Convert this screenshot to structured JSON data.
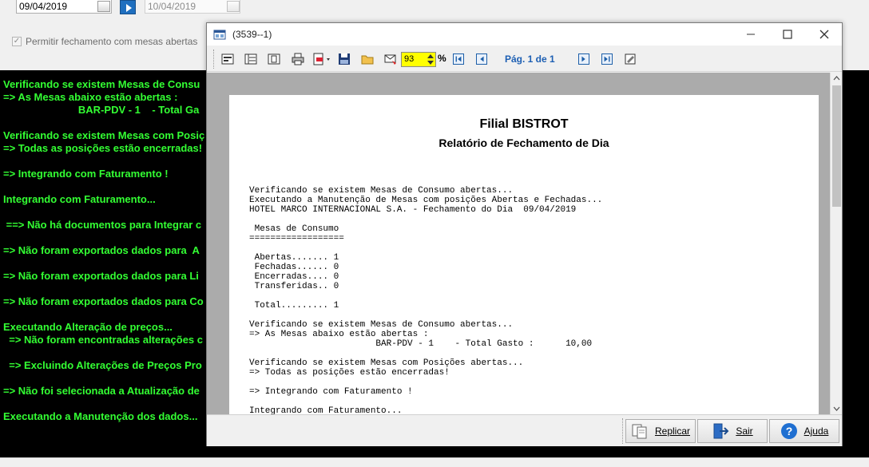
{
  "filter": {
    "date_from": "09/04/2019",
    "date_to": "10/04/2019",
    "permitir_label": "Permitir fechamento com mesas abertas"
  },
  "console_lines": [
    "Verificando se existem Mesas de Consu",
    "=> As Mesas abaixo estão abertas :",
    "                          BAR-PDV - 1    - Total Ga",
    "Verificando se existem Mesas com Posiç",
    "=> Todas as posições estão encerradas!",
    "=> Integrando com Faturamento !",
    "Integrando com Faturamento...",
    " ==> Não há documentos para Integrar c",
    "=> Não foram exportados dados para  A",
    "=> Não foram exportados dados para Li",
    "=> Não foram exportados dados para Co",
    "Executando Alteração de preços...",
    "  => Não foram encontradas alterações c",
    "  => Excluindo Alterações de Preços Pro",
    "=> Não foi selecionada a Atualização de",
    "Executando a Manutenção dos dados..."
  ],
  "dialog": {
    "title": "(3539--1)",
    "zoom": "93",
    "zoom_unit": "%",
    "page_label": "Pág. 1 de 1",
    "report": {
      "title": "Filial BISTROT",
      "subtitle": "Relatório de Fechamento de Dia",
      "lines": [
        "Verificando se existem Mesas de Consumo abertas...",
        "Executando a Manutenção de Mesas com posições Abertas e Fechadas...",
        "HOTEL MARCO INTERNACIONAL S.A. - Fechamento do Dia  09/04/2019",
        "",
        " Mesas de Consumo",
        "==================",
        "",
        " Abertas....... 1",
        " Fechadas...... 0",
        " Encerradas.... 0",
        " Transferidas.. 0",
        "",
        " Total......... 1",
        "",
        "Verificando se existem Mesas de Consumo abertas...",
        "=> As Mesas abaixo estão abertas :",
        "                        BAR-PDV - 1    - Total Gasto :      10,00",
        "",
        "Verificando se existem Mesas com Posições abertas...",
        "=> Todas as posições estão encerradas!",
        "",
        "=> Integrando com Faturamento !",
        "",
        "Integrando com Faturamento..."
      ]
    },
    "buttons": {
      "replicar": "Replicar",
      "sair": "Sair",
      "ajuda": "Ajuda"
    }
  }
}
